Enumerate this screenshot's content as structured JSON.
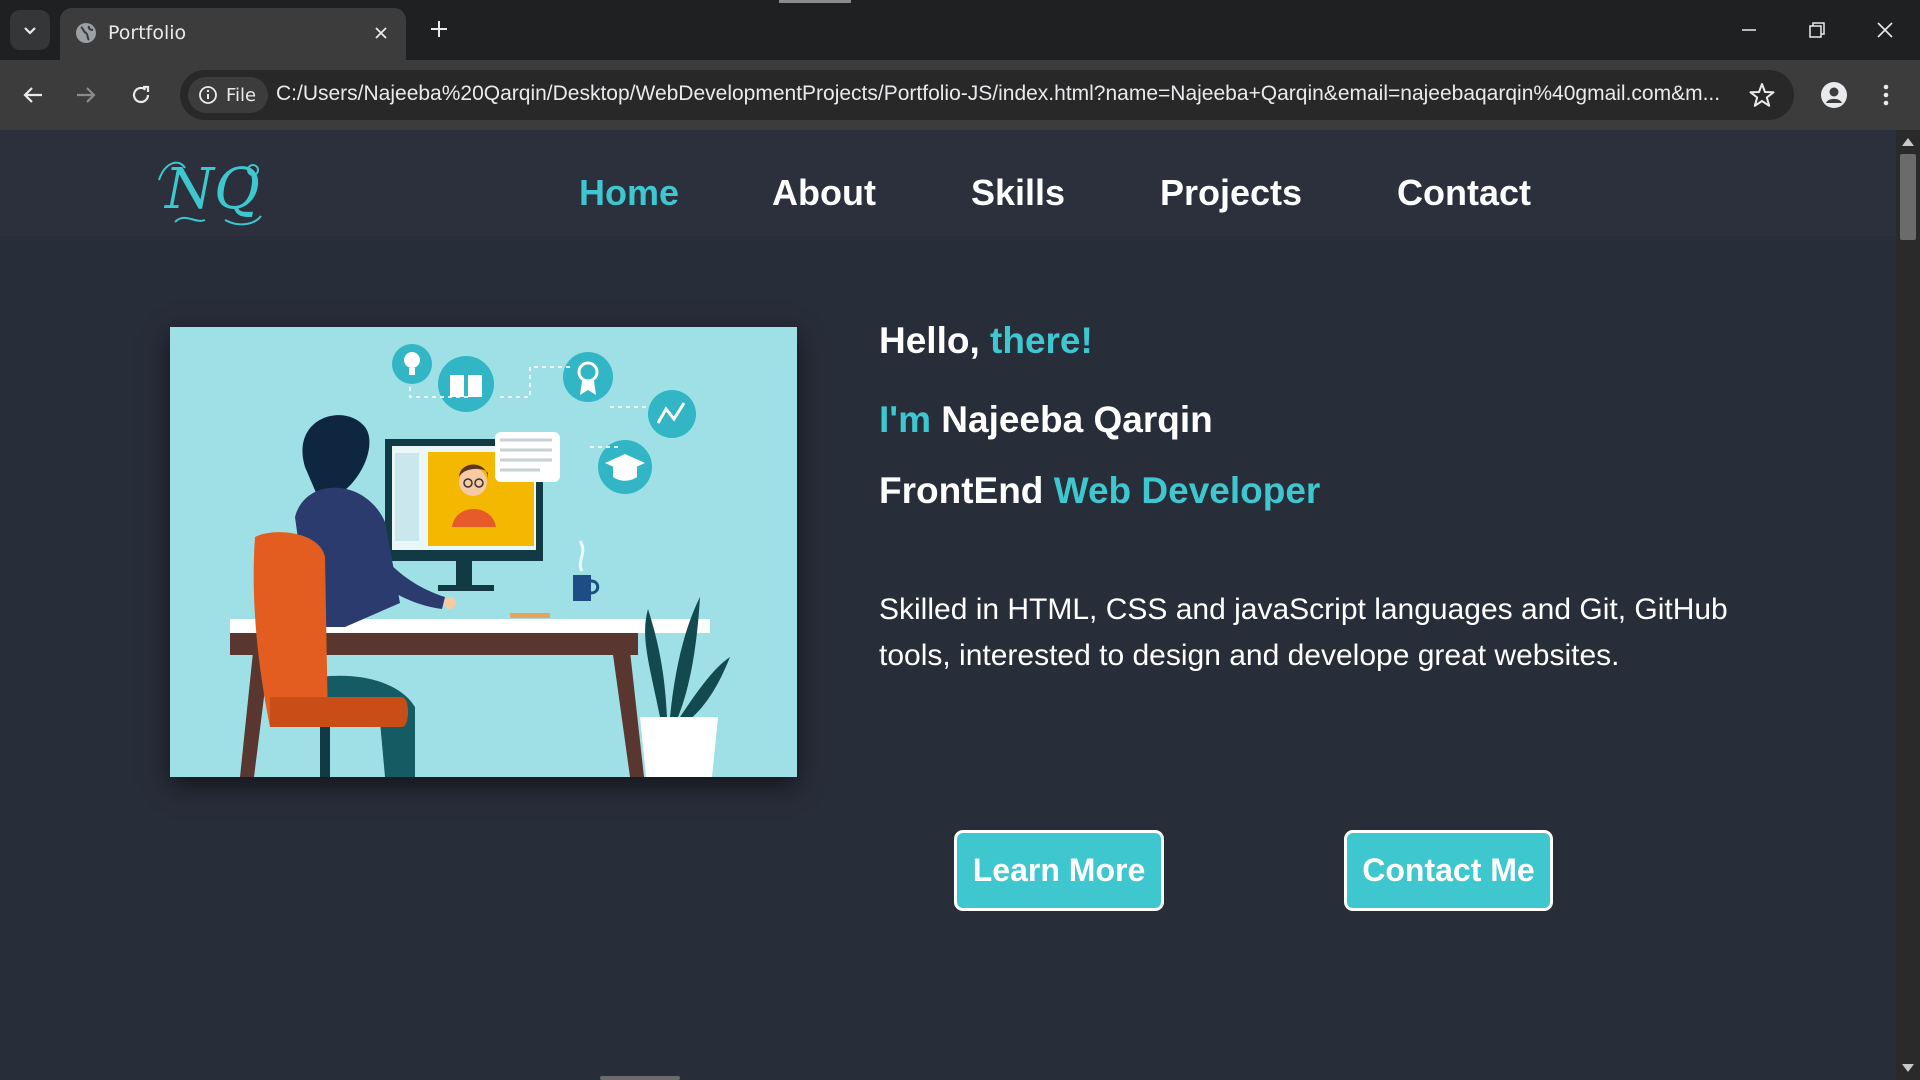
{
  "browser": {
    "tab": {
      "title": "Portfolio"
    },
    "site_chip": "File",
    "url": "C:/Users/Najeeba%20Qarqin/Desktop/WebDevelopmentProjects/Portfolio-JS/index.html?name=Najeeba+Qarqin&email=najeebaqarqin%40gmail.com&m..."
  },
  "site": {
    "logo": "NQ",
    "nav": [
      "Home",
      "About",
      "Skills",
      "Projects",
      "Contact"
    ],
    "active_nav": "Home"
  },
  "hero": {
    "greeting": {
      "text": "Hello,",
      "accent": "there!"
    },
    "intro": {
      "accent": "I'm",
      "name": "Najeeba Qarqin"
    },
    "role": {
      "text": "FrontEnd",
      "accent": "Web Developer"
    },
    "bio": "Skilled in HTML, CSS and javaScript languages and Git, GitHub tools, interested to design and develope great websites.",
    "buttons": {
      "learn_more": "Learn More",
      "contact_me": "Contact Me"
    }
  },
  "colors": {
    "accent": "#3fc7d0",
    "page_bg": "#282d3a",
    "header_bg": "#2b303c",
    "chrome_dark": "#1f2021",
    "chrome_toolbar": "#3c3c3c"
  },
  "icons": [
    "tab-list-icon",
    "globe-icon",
    "close-icon",
    "plus-icon",
    "minimize-icon",
    "restore-icon",
    "window-close-icon",
    "back-icon",
    "forward-icon",
    "reload-icon",
    "info-icon",
    "star-icon",
    "profile-icon",
    "more-icon"
  ]
}
